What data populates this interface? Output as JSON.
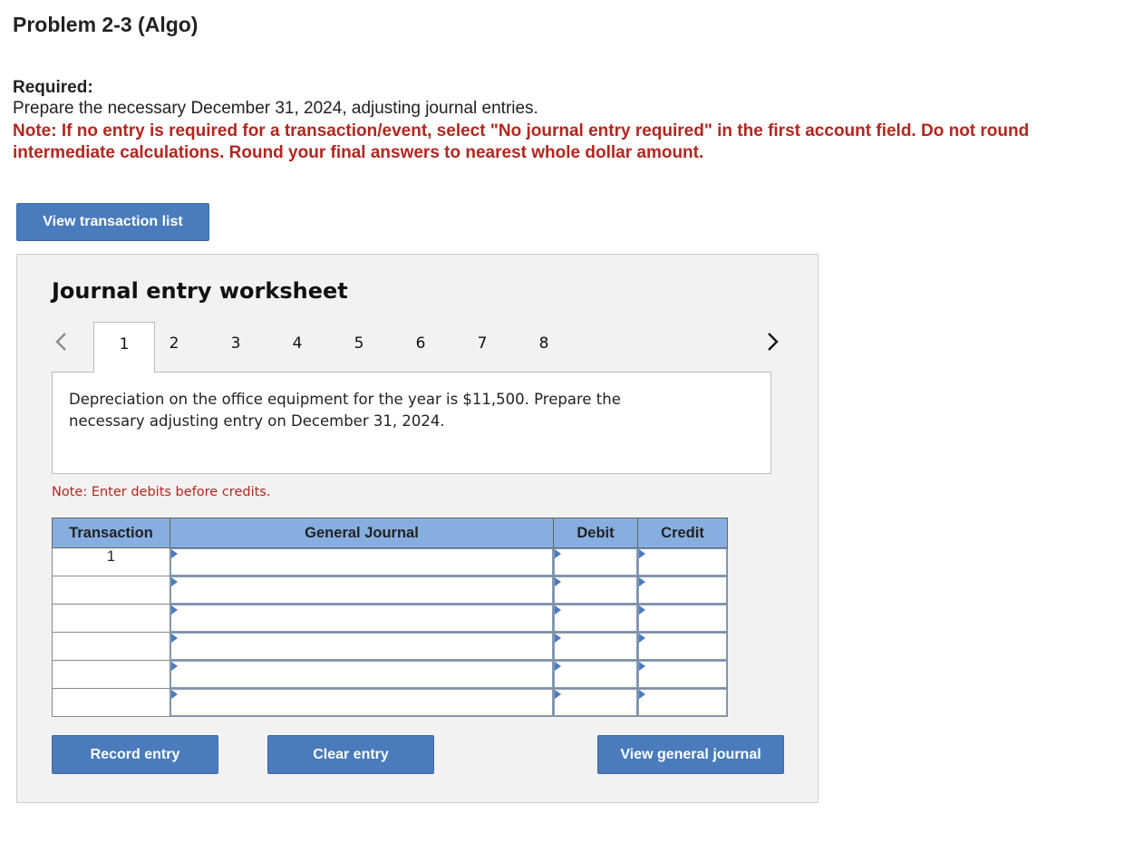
{
  "header": {
    "title": "Problem 2-3 (Algo)",
    "required_label": "Required:",
    "required_text": "Prepare the necessary December 31, 2024, adjusting journal entries.",
    "note": "Note: If no entry is required for a transaction/event, select \"No journal entry required\" in the first account field. Do not round intermediate calculations. Round your final answers to nearest whole dollar amount."
  },
  "buttons": {
    "view_transaction_list": "View transaction list",
    "record_entry": "Record entry",
    "clear_entry": "Clear entry",
    "view_general_journal": "View general journal"
  },
  "worksheet": {
    "title": "Journal entry worksheet",
    "tabs": [
      "1",
      "2",
      "3",
      "4",
      "5",
      "6",
      "7",
      "8"
    ],
    "active_tab": "1",
    "description": "Depreciation on the office equipment for the year is $11,500. Prepare the necessary adjusting entry on December 31, 2024.",
    "debit_note": "Note: Enter debits before credits."
  },
  "table": {
    "headers": {
      "transaction": "Transaction",
      "general_journal": "General Journal",
      "debit": "Debit",
      "credit": "Credit"
    },
    "rows": [
      {
        "transaction": "1",
        "account": "",
        "debit": "",
        "credit": ""
      },
      {
        "transaction": "",
        "account": "",
        "debit": "",
        "credit": ""
      },
      {
        "transaction": "",
        "account": "",
        "debit": "",
        "credit": ""
      },
      {
        "transaction": "",
        "account": "",
        "debit": "",
        "credit": ""
      },
      {
        "transaction": "",
        "account": "",
        "debit": "",
        "credit": ""
      },
      {
        "transaction": "",
        "account": "",
        "debit": "",
        "credit": ""
      }
    ]
  },
  "icons": {
    "prev": "chevron-left-icon",
    "next": "chevron-right-icon",
    "field_marker": "triangle-right-icon"
  },
  "colors": {
    "accent": "#4a7bbc",
    "header_bg": "#87aee0",
    "note_red": "#b3261e",
    "worksheet_bg": "#f2f2f2"
  }
}
